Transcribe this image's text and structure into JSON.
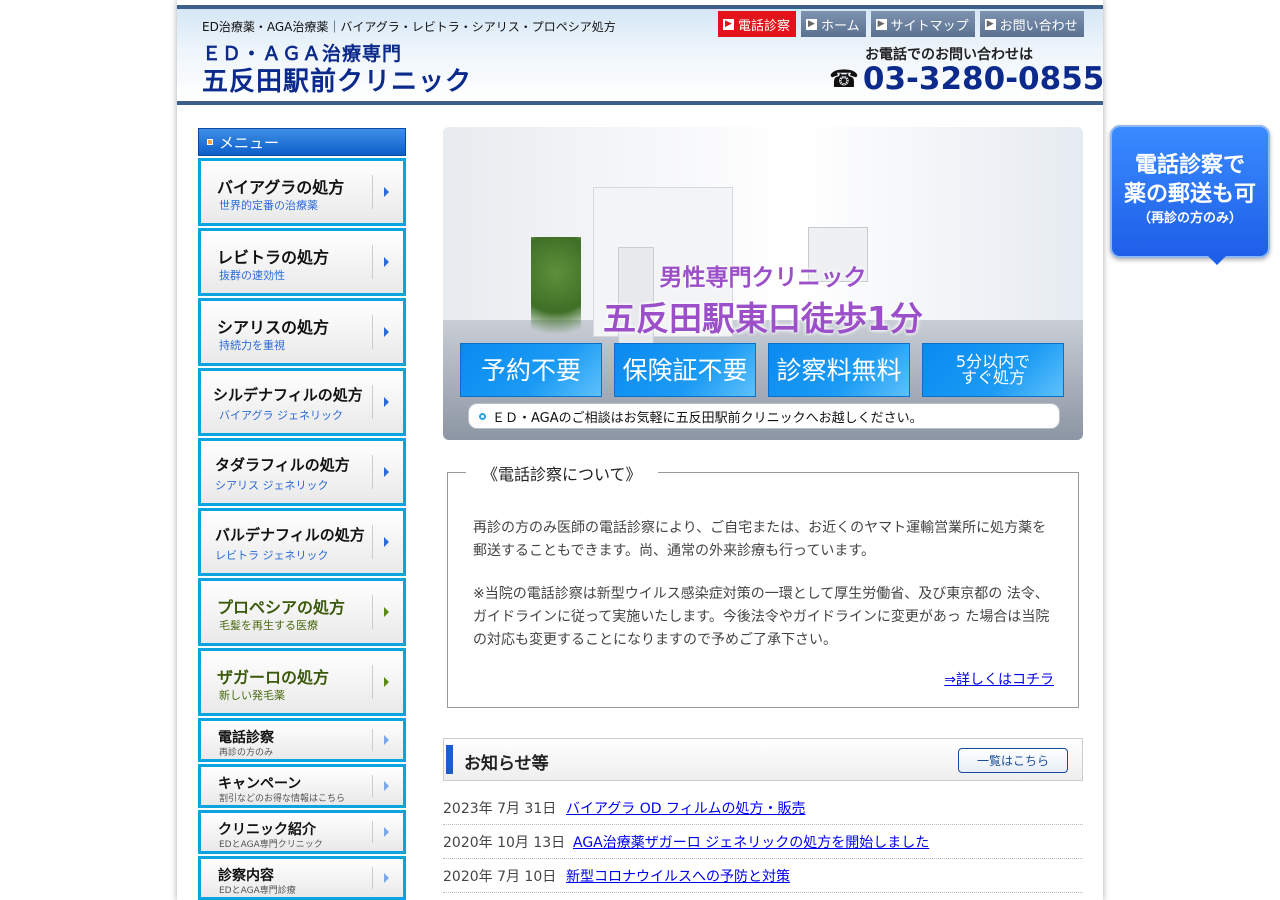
{
  "header": {
    "tagline": "ED治療薬・AGA治療薬｜バイアグラ・レビトラ・シアリス・プロペシア処方",
    "logo_line1": "ＥＤ・ＡＧＡ治療専門",
    "logo_line2": "五反田駅前クリニック",
    "nav": [
      "電話診察",
      "ホーム",
      "サイトマップ",
      "お問い合わせ"
    ],
    "phone_caption": "お電話でのお問い合わせは",
    "phone_icon": "telephone-icon",
    "phone_number": "03-3280-0855"
  },
  "sidebar": {
    "title": "メニュー",
    "items": [
      {
        "title": "バイアグラの処方",
        "sub": "世界的定番の治療薬"
      },
      {
        "title": "レビトラの処方",
        "sub": "抜群の速効性"
      },
      {
        "title": "シアリスの処方",
        "sub": "持続力を重視"
      },
      {
        "title": "シルデナフィルの処方",
        "sub": "バイアグラ ジェネリック"
      },
      {
        "title": "タダラフィルの処方",
        "sub": "シアリス ジェネリック"
      },
      {
        "title": "バルデナフィルの処方",
        "sub": "レビトラ ジェネリック"
      },
      {
        "title": "プロペシアの処方",
        "sub": "毛髪を再生する医療"
      },
      {
        "title": "ザガーロの処方",
        "sub": "新しい発毛薬"
      },
      {
        "title": "電話診察",
        "sub": "再診の方のみ"
      },
      {
        "title": "キャンペーン",
        "sub": "割引などのお得な情報はこちら"
      },
      {
        "title": "クリニック紹介",
        "sub": "EDとAGA専門クリニック"
      },
      {
        "title": "診察内容",
        "sub": "EDとAGA専門診療"
      }
    ]
  },
  "hero": {
    "subtitle": "男性専門クリニック",
    "title": "五反田駅東口徒歩1分",
    "features": [
      "予約不要",
      "保険証不要",
      "診察料無料",
      "5分以内で\nすぐ処方"
    ],
    "bar_text": "ＥＤ・AGAのご相談はお気軽に五反田駅前クリニックへお越しください。"
  },
  "notice": {
    "title": "《電話診察について》",
    "p1": "再診の方のみ医師の電話診察により、ご自宅または、お近くのヤマト運輸営業所に処方薬を郵送することもできます。尚、通常の外来診療も行っています。",
    "p2": "※当院の電話診察は新型ウイルス感染症対策の一環として厚生労働省、及び東京都の 法令、ガイドラインに従って実施いたします。今後法令やガイドラインに変更があっ た場合は当院の対応も変更することになりますので予めご了承下さい。",
    "link": "⇒詳しくはコチラ"
  },
  "news": {
    "title": "お知らせ等",
    "all_button": "一覧はこちら",
    "items": [
      {
        "date": "2023年 7月 31日",
        "text": "バイアグラ OD フィルムの処方・販売"
      },
      {
        "date": "2020年 10月 13日",
        "text": "AGA治療薬ザガーロ ジェネリックの処方を開始しました"
      },
      {
        "date": "2020年 7月 10日",
        "text": "新型コロナウイルスへの予防と対策"
      }
    ]
  },
  "badge": {
    "line1": "電話診察で",
    "line2": "薬の郵送も可",
    "line3": "（再診の方のみ）"
  },
  "colors": {
    "brand": "#0b2a8c",
    "accent": "#0aa4e0",
    "nav_active": "#e4121a",
    "hero_text": "#9b4fc9"
  }
}
